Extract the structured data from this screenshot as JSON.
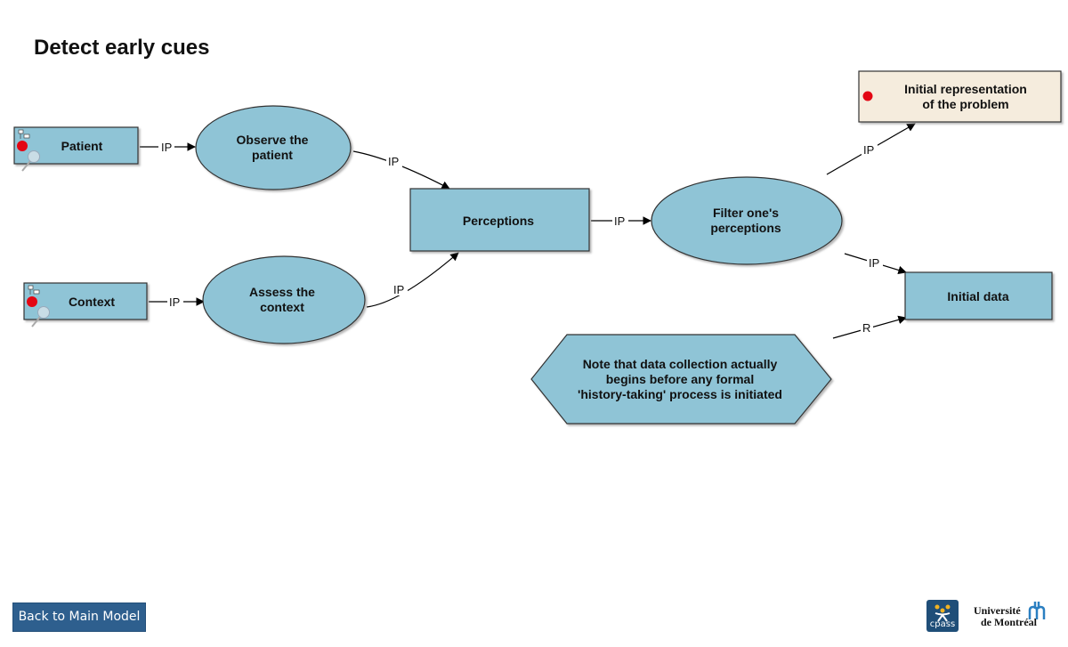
{
  "page": {
    "title": "Detect early cues"
  },
  "colors": {
    "node_fill": "#8fc4d6",
    "node_stroke": "#333333",
    "output_fill": "#f5ecdd",
    "marker_red": "#e30613",
    "button_bg": "#2e5f8e"
  },
  "nodes": {
    "patient": {
      "label": "Patient"
    },
    "context": {
      "label": "Context"
    },
    "observe": {
      "line1": "Observe the",
      "line2": "patient"
    },
    "assess": {
      "line1": "Assess the",
      "line2": "context"
    },
    "perceptions": {
      "label": "Perceptions"
    },
    "filter": {
      "line1": "Filter one's",
      "line2": "perceptions"
    },
    "initial_rep": {
      "line1": "Initial representation",
      "line2": "of the problem"
    },
    "initial_data": {
      "label": "Initial data"
    },
    "note": {
      "line1": "Note that data collection actually",
      "line2": "begins before any formal",
      "line3": "'history-taking' process is initiated"
    }
  },
  "edges": {
    "patient_observe": "IP",
    "context_assess": "IP",
    "observe_perceptions": "IP",
    "assess_perceptions": "IP",
    "perceptions_filter": "IP",
    "filter_initial_rep": "IP",
    "filter_initial_data": "IP",
    "note_initial_data": "R"
  },
  "footer": {
    "back_button": "Back to Main Model",
    "cpass_logo": "cpass",
    "udem_line1": "Université",
    "udem_line2": "de Montréal"
  }
}
